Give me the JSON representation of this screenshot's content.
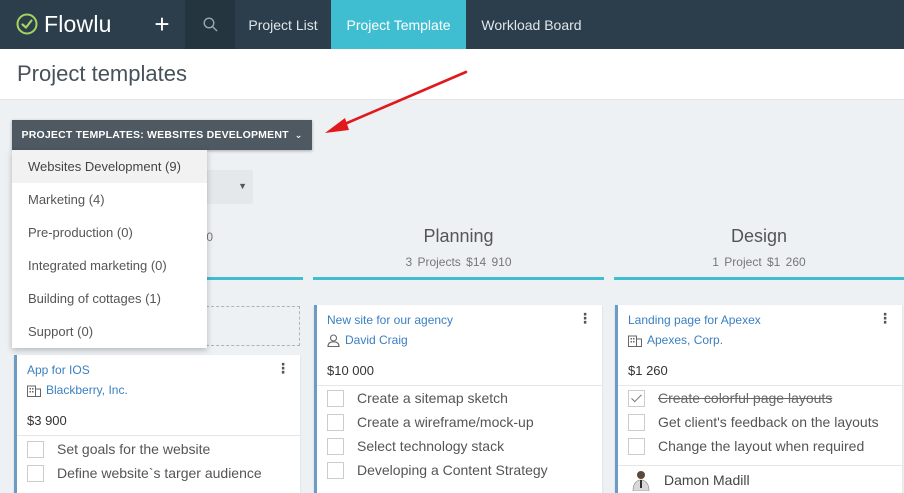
{
  "app": {
    "logo_text": "Flowlu"
  },
  "nav": {
    "tabs": [
      {
        "label": "Project List",
        "active": false
      },
      {
        "label": "Project Template",
        "active": true
      },
      {
        "label": "Workload Board",
        "active": false
      }
    ]
  },
  "page": {
    "title": "Project templates"
  },
  "template_dropdown": {
    "button_label": "PROJECT TEMPLATES: WEBSITES DEVELOPMENT",
    "options": [
      {
        "label": "Websites Development (9)",
        "selected": true
      },
      {
        "label": "Marketing (4)"
      },
      {
        "label": "Pre-production (0)"
      },
      {
        "label": "Integrated marketing (0)"
      },
      {
        "label": "Building of cottages (1)"
      },
      {
        "label": "Support (0)"
      }
    ]
  },
  "columns": [
    {
      "title": "",
      "stats": "0"
    },
    {
      "title": "Planning",
      "stats": "3 Projects  $14 910"
    },
    {
      "title": "Design",
      "stats": "1 Project  $1 260"
    }
  ],
  "cards": [
    {
      "title": "App for IOS",
      "client": "Blackberry, Inc.",
      "client_icon": "building-icon",
      "price": "$3 900",
      "tasks": [
        {
          "label": "Set goals for the website",
          "done": false
        },
        {
          "label": "Define website`s targer audience",
          "done": false
        }
      ]
    },
    {
      "title": "New site for our agency",
      "client": "David Craig",
      "client_icon": "person-icon",
      "price": "$10 000",
      "tasks": [
        {
          "label": "Create a sitemap sketch",
          "done": false
        },
        {
          "label": "Create a wireframe/mock-up",
          "done": false
        },
        {
          "label": "Select technology stack",
          "done": false
        },
        {
          "label": "Developing a Content Strategy",
          "done": false
        }
      ]
    },
    {
      "title": "Landing page for Apexex",
      "client": "Apexes, Corp.",
      "client_icon": "building-icon",
      "price": "$1 260",
      "tasks": [
        {
          "label": "Create colorful page layouts",
          "done": true
        },
        {
          "label": "Get client's feedback on the layouts",
          "done": false
        },
        {
          "label": "Change the layout when required",
          "done": false
        }
      ],
      "person": "Damon Madill"
    }
  ],
  "colors": {
    "accent": "#3fbed1",
    "topbar": "#2c3e4c",
    "link": "#3a7fc1",
    "arrow": "#e0191d"
  }
}
